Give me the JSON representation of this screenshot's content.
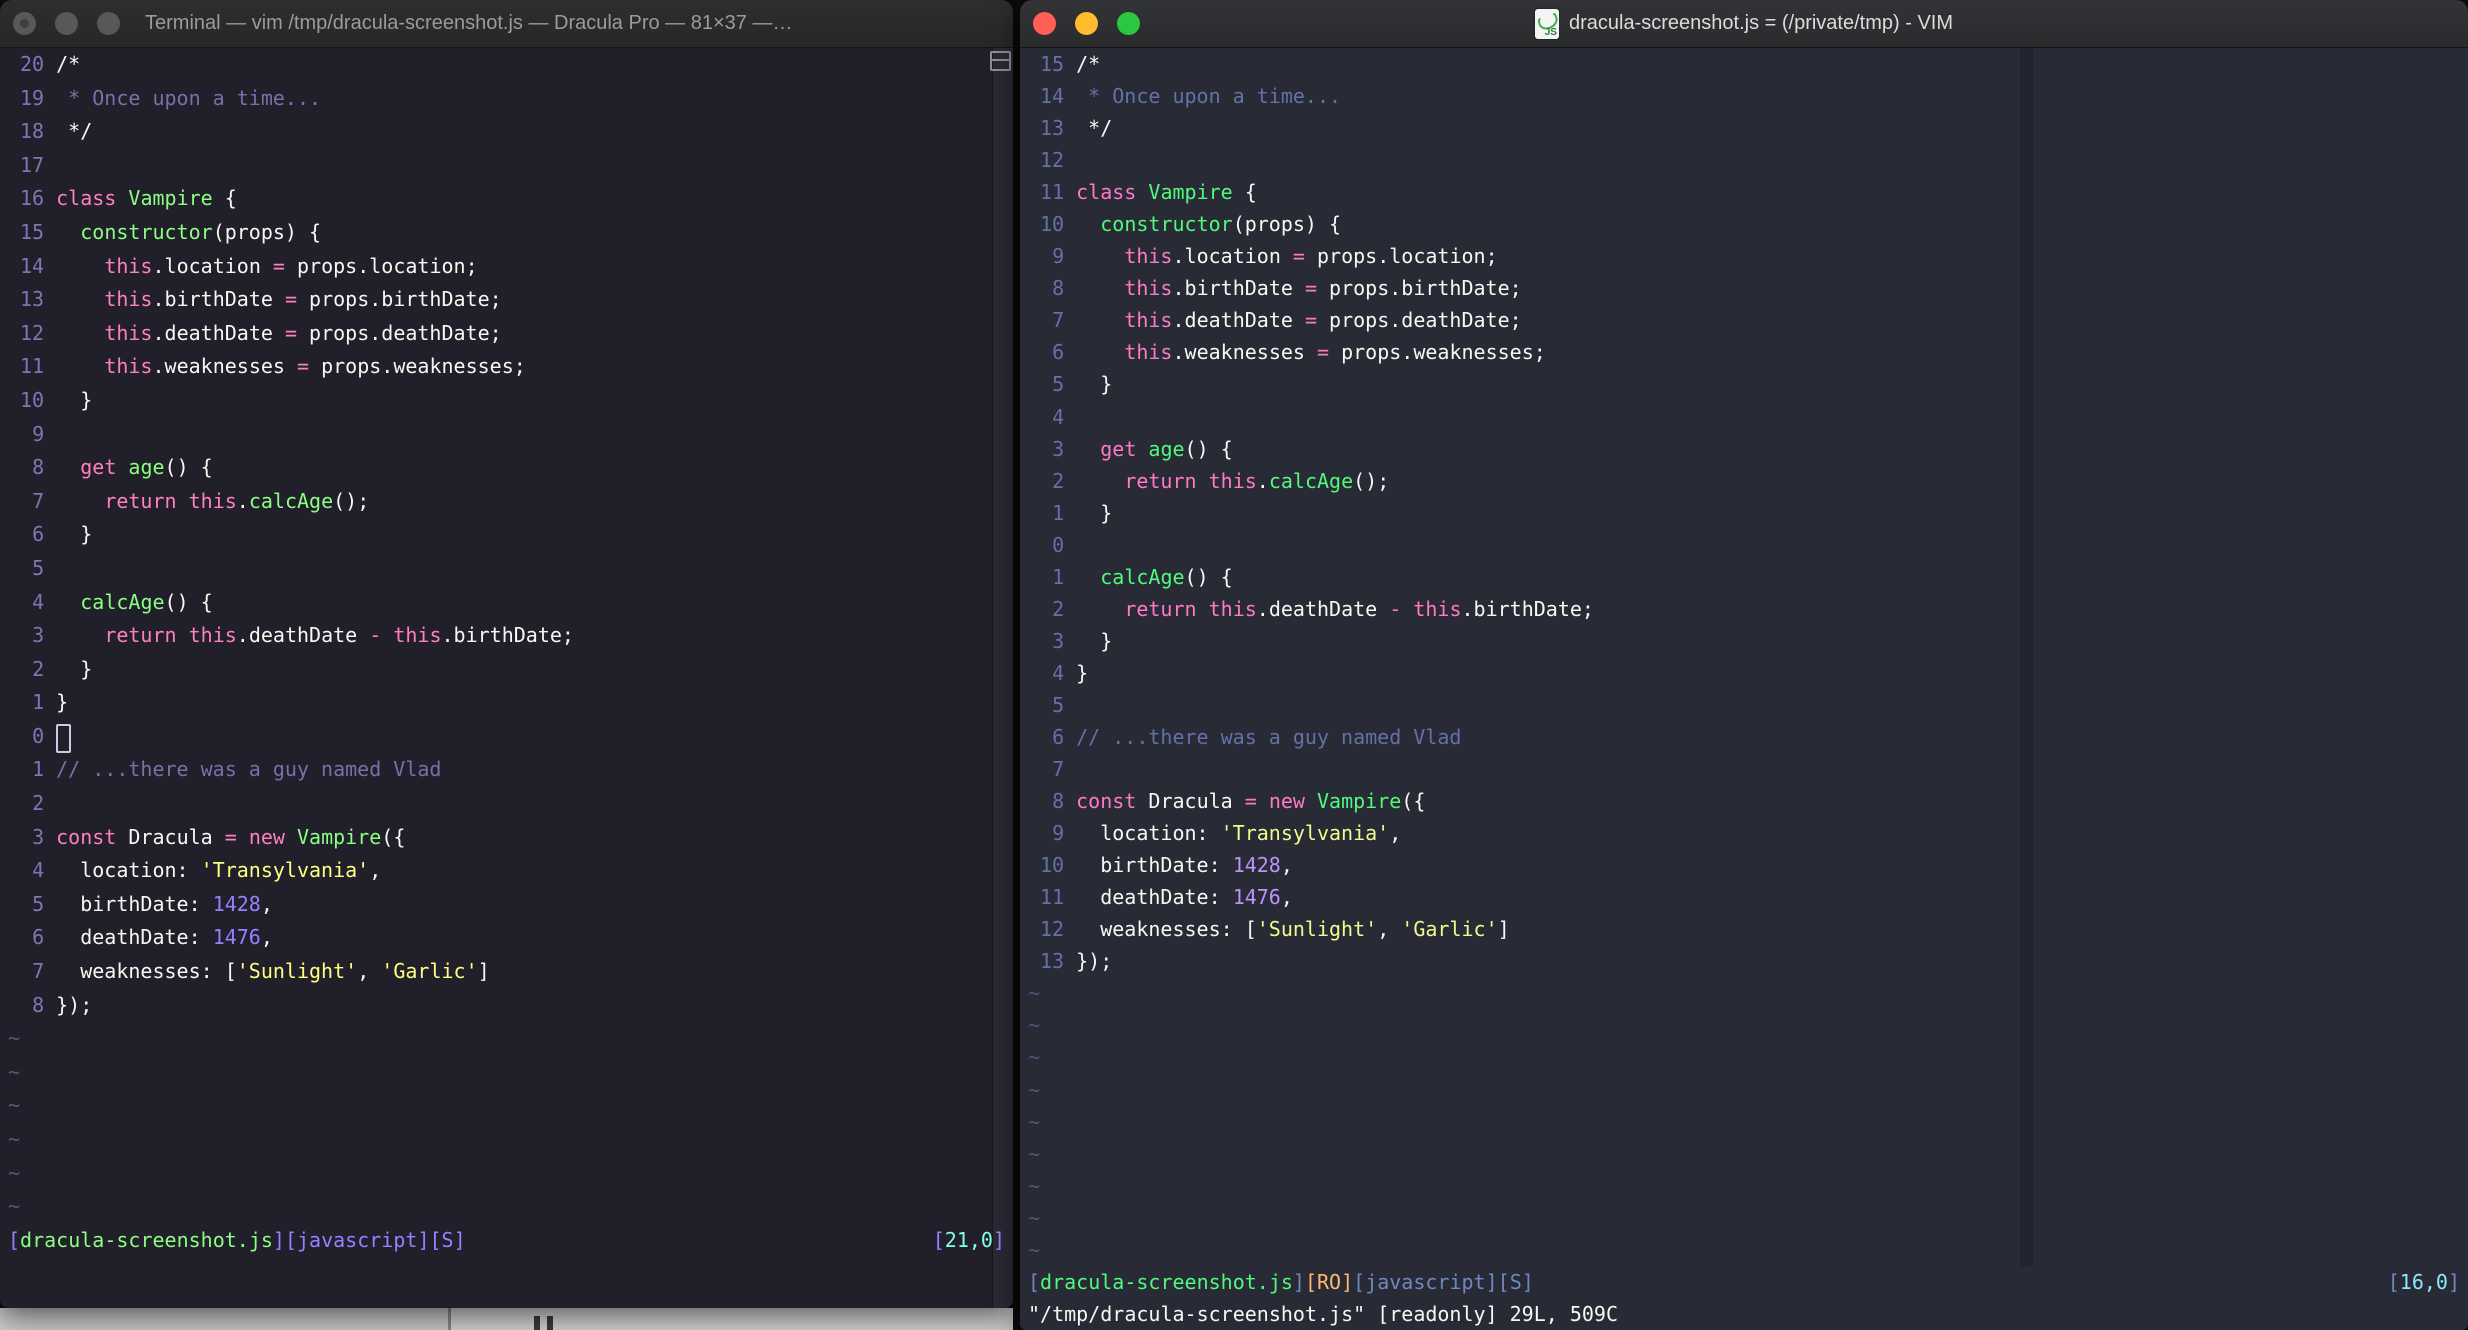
{
  "left_window": {
    "title": "Terminal — vim /tmp/dracula-screenshot.js — Dracula Pro — 81×37 —…",
    "theme": {
      "bg": "#201f2a",
      "fg": "#f8f8f2",
      "comment": "#7970a9",
      "pink": "#ff80bf",
      "green": "#8aff80",
      "yellow": "#ffff80",
      "purple": "#9580ff",
      "cyan": "#80ffea",
      "number": "#7e76b4",
      "tilde": "#5c5480",
      "statusblue": "#9580ff"
    },
    "tilde_count": 6,
    "status_left": [
      [
        "statusblue",
        "["
      ],
      [
        "green",
        "dracula-screenshot.js"
      ],
      [
        "statusblue",
        "]["
      ],
      [
        "statusblue",
        "javascript"
      ],
      [
        "statusblue",
        "]["
      ],
      [
        "statusblue",
        "S"
      ],
      [
        "statusblue",
        "]"
      ]
    ],
    "status_right": [
      [
        "statusblue",
        "["
      ],
      [
        "cyan",
        "21,0"
      ],
      [
        "statusblue",
        "]"
      ]
    ],
    "command_line": ""
  },
  "right_window": {
    "title": "dracula-screenshot.js = (/private/tmp) - VIM",
    "icon": "js-document-icon",
    "theme": {
      "bg": "#282a36",
      "fg": "#f8f8f2",
      "comment": "#6272a4",
      "pink": "#ff79c6",
      "green": "#50fa7b",
      "yellow": "#f1fa8c",
      "purple": "#bd93f9",
      "cyan": "#8be9fd",
      "orange": "#ffb86c",
      "number": "#6272a4",
      "tilde": "#4c5878",
      "statusblue": "#7188be",
      "colorcolumn": "#22232e"
    },
    "tilde_count": 9,
    "status_left": [
      [
        "statusblue",
        "["
      ],
      [
        "green",
        "dracula-screenshot.js"
      ],
      [
        "statusblue",
        "]"
      ],
      [
        "orange",
        "[RO]"
      ],
      [
        "statusblue",
        "["
      ],
      [
        "statusblue",
        "javascript"
      ],
      [
        "statusblue",
        "]["
      ],
      [
        "statusblue",
        "S"
      ],
      [
        "statusblue",
        "]"
      ]
    ],
    "status_right": [
      [
        "statusblue",
        "["
      ],
      [
        "cyan",
        "16,0"
      ],
      [
        "statusblue",
        "]"
      ]
    ],
    "message_line": "\"/tmp/dracula-screenshot.js\" [readonly] 29L, 509C"
  },
  "code": {
    "lines": [
      {
        "nl": "20",
        "nr": "15",
        "tokens": [
          [
            "fg",
            "/*"
          ]
        ]
      },
      {
        "nl": "19",
        "nr": "14",
        "tokens": [
          [
            "comment",
            " * Once upon a time..."
          ]
        ]
      },
      {
        "nl": "18",
        "nr": "13",
        "tokens": [
          [
            "fg",
            " */"
          ]
        ]
      },
      {
        "nl": "17",
        "nr": "12",
        "tokens": []
      },
      {
        "nl": "16",
        "nr": "11",
        "tokens": [
          [
            "pink",
            "class"
          ],
          [
            "fg",
            " "
          ],
          [
            "green",
            "Vampire"
          ],
          [
            "fg",
            " {"
          ]
        ]
      },
      {
        "nl": "15",
        "nr": "10",
        "tokens": [
          [
            "fg",
            "  "
          ],
          [
            "green",
            "constructor"
          ],
          [
            "fg",
            "(props) {"
          ]
        ]
      },
      {
        "nl": "14",
        "nr": "9",
        "tokens": [
          [
            "fg",
            "    "
          ],
          [
            "pink",
            "this"
          ],
          [
            "fg",
            ".location "
          ],
          [
            "pink",
            "="
          ],
          [
            "fg",
            " props.location;"
          ]
        ]
      },
      {
        "nl": "13",
        "nr": "8",
        "tokens": [
          [
            "fg",
            "    "
          ],
          [
            "pink",
            "this"
          ],
          [
            "fg",
            ".birthDate "
          ],
          [
            "pink",
            "="
          ],
          [
            "fg",
            " props.birthDate;"
          ]
        ]
      },
      {
        "nl": "12",
        "nr": "7",
        "tokens": [
          [
            "fg",
            "    "
          ],
          [
            "pink",
            "this"
          ],
          [
            "fg",
            ".deathDate "
          ],
          [
            "pink",
            "="
          ],
          [
            "fg",
            " props.deathDate;"
          ]
        ]
      },
      {
        "nl": "11",
        "nr": "6",
        "tokens": [
          [
            "fg",
            "    "
          ],
          [
            "pink",
            "this"
          ],
          [
            "fg",
            ".weaknesses "
          ],
          [
            "pink",
            "="
          ],
          [
            "fg",
            " props.weaknesses;"
          ]
        ]
      },
      {
        "nl": "10",
        "nr": "5",
        "tokens": [
          [
            "fg",
            "  }"
          ]
        ]
      },
      {
        "nl": "9",
        "nr": "4",
        "tokens": []
      },
      {
        "nl": "8",
        "nr": "3",
        "tokens": [
          [
            "fg",
            "  "
          ],
          [
            "pink",
            "get"
          ],
          [
            "fg",
            " "
          ],
          [
            "green",
            "age"
          ],
          [
            "fg",
            "() {"
          ]
        ]
      },
      {
        "nl": "7",
        "nr": "2",
        "tokens": [
          [
            "fg",
            "    "
          ],
          [
            "pink",
            "return"
          ],
          [
            "fg",
            " "
          ],
          [
            "pink",
            "this"
          ],
          [
            "fg",
            "."
          ],
          [
            "green",
            "calcAge"
          ],
          [
            "fg",
            "();"
          ]
        ]
      },
      {
        "nl": "6",
        "nr": "1",
        "tokens": [
          [
            "fg",
            "  }"
          ]
        ]
      },
      {
        "nl": "5",
        "nr": "0",
        "cursor_right": true,
        "tokens": []
      },
      {
        "nl": "4",
        "nr": "1",
        "tokens": [
          [
            "fg",
            "  "
          ],
          [
            "green",
            "calcAge"
          ],
          [
            "fg",
            "() {"
          ]
        ]
      },
      {
        "nl": "3",
        "nr": "2",
        "tokens": [
          [
            "fg",
            "    "
          ],
          [
            "pink",
            "return"
          ],
          [
            "fg",
            " "
          ],
          [
            "pink",
            "this"
          ],
          [
            "fg",
            ".deathDate "
          ],
          [
            "pink",
            "-"
          ],
          [
            "fg",
            " "
          ],
          [
            "pink",
            "this"
          ],
          [
            "fg",
            ".birthDate;"
          ]
        ]
      },
      {
        "nl": "2",
        "nr": "3",
        "tokens": [
          [
            "fg",
            "  }"
          ]
        ]
      },
      {
        "nl": "1",
        "nr": "4",
        "tokens": [
          [
            "fg",
            "}"
          ]
        ]
      },
      {
        "nl": "0",
        "nr": "5",
        "cursor_left": true,
        "tokens": []
      },
      {
        "nl": "1",
        "nr": "6",
        "tokens": [
          [
            "comment",
            "// ...there was a guy named Vlad"
          ]
        ]
      },
      {
        "nl": "2",
        "nr": "7",
        "tokens": []
      },
      {
        "nl": "3",
        "nr": "8",
        "tokens": [
          [
            "pink",
            "const"
          ],
          [
            "fg",
            " Dracula "
          ],
          [
            "pink",
            "="
          ],
          [
            "fg",
            " "
          ],
          [
            "pink",
            "new"
          ],
          [
            "fg",
            " "
          ],
          [
            "green",
            "Vampire"
          ],
          [
            "fg",
            "({"
          ]
        ]
      },
      {
        "nl": "4",
        "nr": "9",
        "tokens": [
          [
            "fg",
            "  location: "
          ],
          [
            "yellow",
            "'Transylvania'"
          ],
          [
            "fg",
            ","
          ]
        ]
      },
      {
        "nl": "5",
        "nr": "10",
        "tokens": [
          [
            "fg",
            "  birthDate: "
          ],
          [
            "purple",
            "1428"
          ],
          [
            "fg",
            ","
          ]
        ]
      },
      {
        "nl": "6",
        "nr": "11",
        "tokens": [
          [
            "fg",
            "  deathDate: "
          ],
          [
            "purple",
            "1476"
          ],
          [
            "fg",
            ","
          ]
        ]
      },
      {
        "nl": "7",
        "nr": "12",
        "tokens": [
          [
            "fg",
            "  weaknesses: ["
          ],
          [
            "yellow",
            "'Sunlight'"
          ],
          [
            "fg",
            ", "
          ],
          [
            "yellow",
            "'Garlic'"
          ],
          [
            "fg",
            "]"
          ]
        ]
      },
      {
        "nl": "8",
        "nr": "13",
        "tokens": [
          [
            "fg",
            "});"
          ]
        ]
      }
    ]
  },
  "traffic_lights": {
    "close": "#ff5f57",
    "minimize": "#febc2e",
    "zoom": "#28c840",
    "inactive": "#585858"
  }
}
